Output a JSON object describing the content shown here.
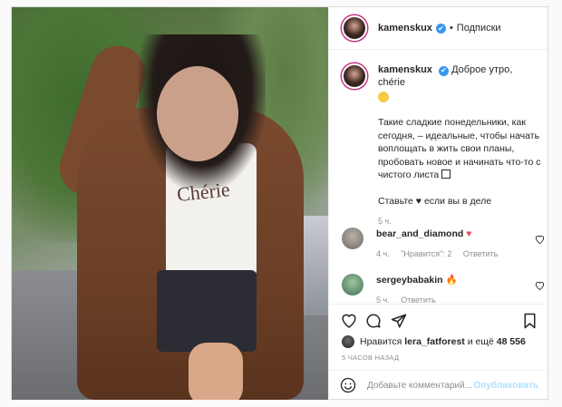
{
  "post": {
    "username": "kamenskux",
    "follow_label": "Подписки",
    "dot": "•",
    "caption_greeting": "Доброе утро, chérie",
    "caption_paragraph1": "Такие сладкие понедельники, как сегодня, – идеальные, чтобы начать воплощать в жить свои планы, пробовать новое и начинать что-то с чистого листа",
    "caption_paragraph2": "Ставьте ♥ если вы в деле",
    "caption_time": "5 ч.",
    "shirt_text": "Chérie"
  },
  "comments": [
    {
      "username": "bear_and_diamond",
      "text": "♥",
      "time": "4 ч.",
      "likes": "\"Нравится\": 2",
      "reply": "Ответить"
    },
    {
      "username": "sergeybabakin",
      "text": "🔥",
      "time": "5 ч.",
      "reply": "Ответить"
    }
  ],
  "likes": {
    "prefix": "Нравится",
    "user": "lera_fatforest",
    "and_more": "и ещё",
    "count": "48 556"
  },
  "ago": "5 ЧАСОВ НАЗАД",
  "add_comment": {
    "placeholder": "Добавьте комментарий...",
    "post_label": "Опубликовать"
  },
  "icons": {
    "verified": "✔"
  },
  "colors": {
    "accent": "#3897f0",
    "ring": "#c13584",
    "post_disabled": "#b2dffc"
  }
}
